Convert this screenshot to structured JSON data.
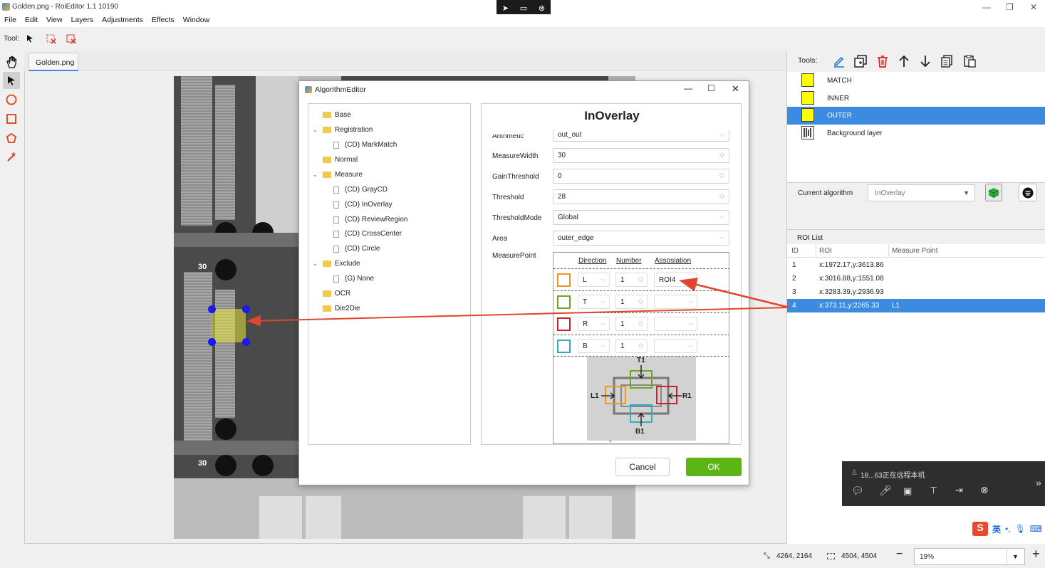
{
  "window": {
    "title": "Golden.png - RoiEditor 1.1 10190"
  },
  "menu": [
    "File",
    "Edit",
    "View",
    "Layers",
    "Adjustments",
    "Effects",
    "Window"
  ],
  "toolbar": {
    "tool_label": "Tool:"
  },
  "tabs": [
    {
      "label": "Golden.png"
    }
  ],
  "canvas": {
    "labels": [
      "30",
      "30"
    ]
  },
  "dialog": {
    "title": "AlgorithmEditor",
    "tree": [
      {
        "label": "Base",
        "type": "folder",
        "level": 0
      },
      {
        "label": "Registration",
        "type": "folder",
        "level": 0,
        "expanded": true
      },
      {
        "label": "(CD) MarkMatch",
        "type": "file",
        "level": 1
      },
      {
        "label": "Normal",
        "type": "folder",
        "level": 0
      },
      {
        "label": "Measure",
        "type": "folder",
        "level": 0,
        "expanded": true
      },
      {
        "label": "(CD) GrayCD",
        "type": "file",
        "level": 1
      },
      {
        "label": "(CD) InOverlay",
        "type": "file",
        "level": 1
      },
      {
        "label": "(CD) ReviewRegion",
        "type": "file",
        "level": 1
      },
      {
        "label": "(CD) CrossCenter",
        "type": "file",
        "level": 1
      },
      {
        "label": "(CD) Circle",
        "type": "file",
        "level": 1
      },
      {
        "label": "Exclude",
        "type": "folder",
        "level": 0,
        "expanded": true
      },
      {
        "label": "(G) None",
        "type": "file",
        "level": 1
      },
      {
        "label": "OCR",
        "type": "folder",
        "level": 0
      },
      {
        "label": "Die2Die",
        "type": "folder",
        "level": 0
      }
    ],
    "props_title": "InOverlay",
    "props": [
      {
        "label": "Arithmetic",
        "value": "out_out",
        "kind": "select"
      },
      {
        "label": "MeasureWidth",
        "value": "30",
        "kind": "spin"
      },
      {
        "label": "GainThreshold",
        "value": "0",
        "kind": "spin"
      },
      {
        "label": "Threshold",
        "value": "28",
        "kind": "spin"
      },
      {
        "label": "ThresholdMode",
        "value": "Global",
        "kind": "select"
      },
      {
        "label": "Area",
        "value": "outer_edge",
        "kind": "select"
      }
    ],
    "measure_point": {
      "label": "MeasurePoint",
      "headers": [
        "Direction",
        "Number",
        "Assosiation"
      ],
      "rows": [
        {
          "color": "#f0961e",
          "direction": "L",
          "number": "1",
          "association": "ROI4"
        },
        {
          "color": "#6aa820",
          "direction": "T",
          "number": "1",
          "association": ""
        },
        {
          "color": "#d0202a",
          "direction": "R",
          "number": "1",
          "association": ""
        },
        {
          "color": "#2ab0c0",
          "direction": "B",
          "number": "1",
          "association": ""
        }
      ],
      "diagram_labels": {
        "top": "T1",
        "left": "L1",
        "right": "R1",
        "bottom": "B1"
      }
    },
    "cancel_label": "Cancel",
    "ok_label": "OK"
  },
  "right": {
    "tools_label": "Tools:",
    "layers": [
      {
        "name": "MATCH",
        "selected": false
      },
      {
        "name": "INNER",
        "selected": false
      },
      {
        "name": "OUTER",
        "selected": true
      },
      {
        "name": "Background layer",
        "selected": false
      }
    ],
    "current_algorithm_label": "Current algorithm",
    "current_algorithm_value": "InOverlay",
    "roi_list_label": "ROI List",
    "roi_headers": [
      "ID",
      "ROI",
      "Measure Point"
    ],
    "roi_rows": [
      {
        "id": "1",
        "roi": "x:1972.17,y:3613.86",
        "mp": "",
        "selected": false
      },
      {
        "id": "2",
        "roi": "x:3016.88,y:1551.08",
        "mp": "",
        "selected": false
      },
      {
        "id": "3",
        "roi": "x:3283.39,y:2936.93",
        "mp": "",
        "selected": false
      },
      {
        "id": "4",
        "roi": "x:373.11,y:2265.33",
        "mp": "L1",
        "selected": true
      }
    ]
  },
  "remote": {
    "text": "18...63正在远程本机"
  },
  "ime": {
    "text": "英"
  },
  "status": {
    "cursor": "4264, 2164",
    "size": "4504, 4504",
    "zoom": "19%"
  },
  "colors": {
    "accent": "#3b8be0",
    "ok": "#5cb515",
    "arrow": "#e0452e",
    "selection": "#3b8be0"
  }
}
